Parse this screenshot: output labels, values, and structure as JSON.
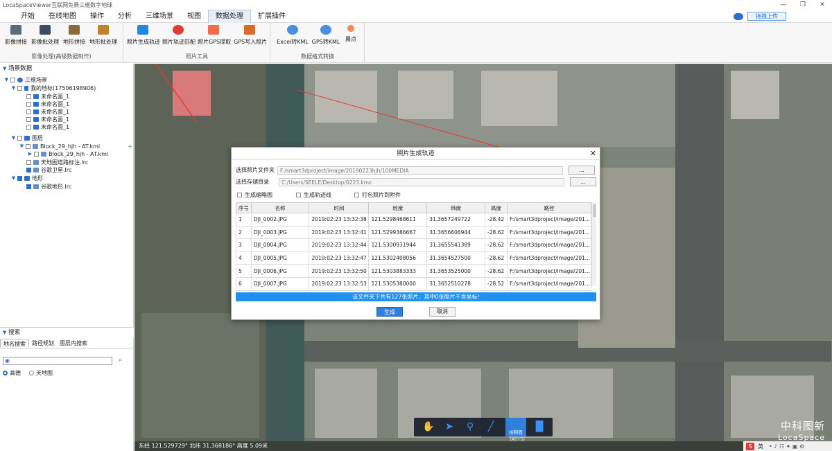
{
  "window": {
    "title": "LocaSpaceViewer互联网免费三维数字地球",
    "controls": [
      "—",
      "❐",
      "✕"
    ]
  },
  "menu": {
    "items": [
      "开始",
      "在线地图",
      "操作",
      "分析",
      "三维场景",
      "视图",
      "数据处理",
      "扩展插件"
    ],
    "active_index": 6,
    "upload_label": "拖拽上传"
  },
  "ribbon": {
    "group1": {
      "label": "影像处理(高级数据制作)",
      "buttons": [
        "影像拼接",
        "影像批处理",
        "地形拼接",
        "地形批处理"
      ]
    },
    "group2": {
      "label": "照片工具",
      "buttons": [
        "照片生成轨迹",
        "照片轨迹匹配",
        "照片GPS提取",
        "GPS写入照片"
      ]
    },
    "group3": {
      "label": "数据格式转换",
      "buttons": [
        "Excel转KML",
        "GPS转KML",
        "晨点"
      ]
    }
  },
  "left_panel": {
    "scene_title": "场景数据",
    "tree": [
      {
        "label": "三维场景",
        "level": 0,
        "checked": false
      },
      {
        "label": "我的地标(17506198906)",
        "level": 1,
        "checked": false
      },
      {
        "label": "未命名面_1",
        "level": 2,
        "checked": false
      },
      {
        "label": "未命名面_1",
        "level": 2,
        "checked": false
      },
      {
        "label": "未命名面_1",
        "level": 2,
        "checked": false
      },
      {
        "label": "未命名面_1",
        "level": 2,
        "checked": false
      },
      {
        "label": "未命名面_1",
        "level": 2,
        "checked": false
      },
      {
        "label": "图层",
        "level": 0,
        "checked": false
      },
      {
        "label": "Block_29_hjh - AT.kml",
        "level": 1,
        "checked": false
      },
      {
        "label": "Block_29_hjh - AT.kml",
        "level": 2,
        "checked": false
      },
      {
        "label": "天地图道路标注.lrc",
        "level": 1,
        "checked": false
      },
      {
        "label": "谷歌卫星.lrc",
        "level": 1,
        "checked": true
      },
      {
        "label": "地形",
        "level": 0,
        "checked": true
      },
      {
        "label": "谷歌地形.lrc",
        "level": 1,
        "checked": true
      }
    ],
    "search_title": "搜索",
    "search_tabs": [
      "地名搜索",
      "路径规划",
      "图层内搜索"
    ],
    "radio_options": [
      "高德",
      "天地图"
    ]
  },
  "dialog": {
    "title": "照片生成轨迹",
    "close": "✕",
    "photo_folder_label": "选择照片文件夹",
    "photo_folder_value": "F:/smart3dproject/image/20190223hjh/100MEDIA",
    "save_dir_label": "选择存储目录",
    "save_dir_value": "C:/Users/SEELE/Desktop/0223.kmz",
    "browse": "...",
    "options": [
      "生成缩略图",
      "生成轨迹线",
      "打包照片到附件"
    ],
    "columns": [
      "序号",
      "名称",
      "时间",
      "经度",
      "纬度",
      "高度",
      "路径"
    ],
    "rows": [
      [
        "1",
        "DJI_0002.JPG",
        "2019:02:23 13:32:38",
        "121.5298468611",
        "31.3657249722",
        "-28.42",
        "F:/smart3dproject/image/201..."
      ],
      [
        "2",
        "DJI_0003.JPG",
        "2019:02:23 13:32:41",
        "121.5299386667",
        "31.3656606944",
        "-28.62",
        "F:/smart3dproject/image/201..."
      ],
      [
        "3",
        "DJI_0004.JPG",
        "2019:02:23 13:32:44",
        "121.5300931944",
        "31.3655541389",
        "-28.62",
        "F:/smart3dproject/image/201..."
      ],
      [
        "4",
        "DJI_0005.JPG",
        "2019:02:23 13:32:47",
        "121.5302408056",
        "31.3654527500",
        "-28.62",
        "F:/smart3dproject/image/201..."
      ],
      [
        "5",
        "DJI_0006.JPG",
        "2019:02:23 13:32:50",
        "121.5303883333",
        "31.3653525000",
        "-28.62",
        "F:/smart3dproject/image/201..."
      ],
      [
        "6",
        "DJI_0007.JPG",
        "2019:02:23 13:32:53",
        "121.5305380000",
        "31.3652510278",
        "-28.52",
        "F:/smart3dproject/image/201..."
      ]
    ],
    "info": "该文件夹下共有127张照片，其中0张照片不含坐标!",
    "generate": "生成",
    "cancel": "取消"
  },
  "toolbar": {
    "draw_label": "绘制面",
    "draw_shortcut": "(Alt+5)"
  },
  "status": {
    "text": "东经 121.529729°  北纬 31.368186°  高度 5.09米"
  },
  "watermark": {
    "cn": "中科图新",
    "en": "LocaSpace"
  },
  "tray": {
    "ime": "英"
  },
  "colors": {
    "accent": "#2b7fe0",
    "info_bar": "#1e90f0",
    "arrow": "#e53935"
  }
}
